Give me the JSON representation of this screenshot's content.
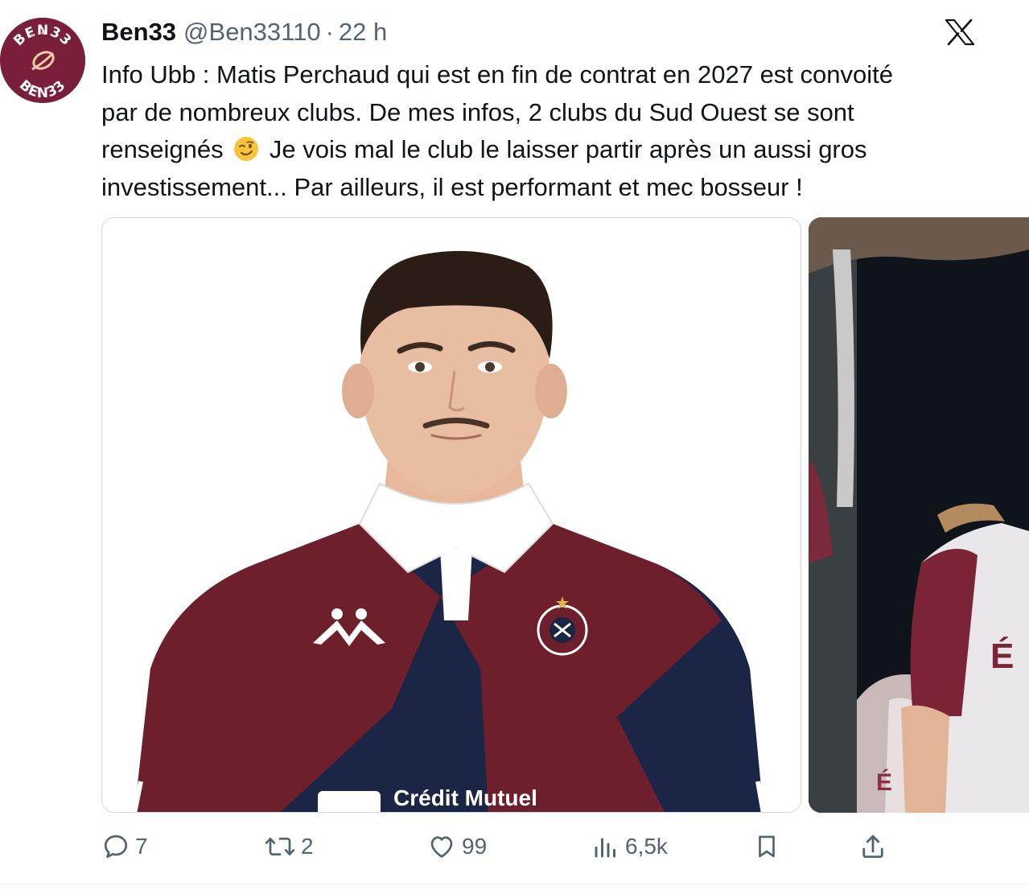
{
  "author": {
    "display_name": "Ben33",
    "handle": "@Ben33110",
    "separator": "·",
    "time": "22 h",
    "avatar_text_top": "BEN33",
    "avatar_text_bottom": "BEN33"
  },
  "tweet": {
    "lines": [
      "Info Ubb : Matis Perchaud qui est en fin de contrat en 2027 est convoité",
      "par de nombreux clubs. De mes infos, 2 clubs du Sud Ouest se sont",
      "renseignés",
      "Je vois mal le club le laisser partir après un aussi gros",
      "investissement... Par ailleurs, il est performant et mec bosseur !"
    ],
    "emoji": "winking-face"
  },
  "media": {
    "image1": {
      "sponsor_text": "Crédit Mutuel",
      "brand": "kappa"
    },
    "image2": {
      "jersey_letter": "É"
    }
  },
  "actions": {
    "replies": "7",
    "reposts": "2",
    "likes": "99",
    "views": "6,5k"
  },
  "colors": {
    "text": "#0f1419",
    "secondary": "#536471",
    "border": "#cfd9de",
    "avatar_bg": "#7a1f3a",
    "jersey_maroon": "#6e1f2c",
    "jersey_navy": "#1b2546"
  },
  "icons": [
    "x-logo-icon",
    "reply-icon",
    "repost-icon",
    "like-icon",
    "views-icon",
    "bookmark-icon",
    "share-icon",
    "winking-face-emoji"
  ]
}
